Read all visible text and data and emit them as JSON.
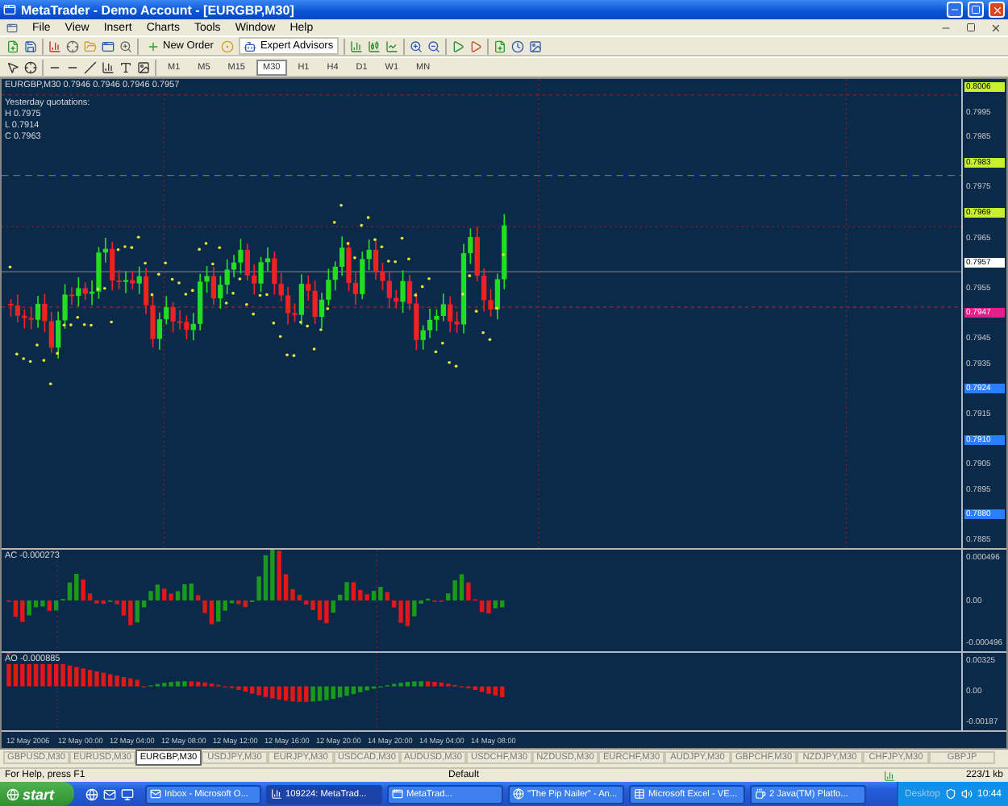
{
  "window": {
    "title": "MetaTrader - Demo Account - [EURGBP,M30]"
  },
  "menu": [
    "File",
    "View",
    "Insert",
    "Charts",
    "Tools",
    "Window",
    "Help"
  ],
  "toolbar": {
    "buttons": [
      "New Order",
      "Expert Advisors"
    ]
  },
  "timeframes": [
    {
      "label": "M1",
      "selected": false
    },
    {
      "label": "M5",
      "selected": false
    },
    {
      "label": "M15",
      "selected": false
    },
    {
      "label": "M30",
      "selected": true
    },
    {
      "label": "H1",
      "selected": false
    },
    {
      "label": "H4",
      "selected": false
    },
    {
      "label": "D1",
      "selected": false
    },
    {
      "label": "W1",
      "selected": false
    },
    {
      "label": "MN",
      "selected": false
    }
  ],
  "chart": {
    "header": "EURGBP,M30  0.7946 0.7946 0.7946 0.7957",
    "quotes_title": "Yesterday quotations:",
    "quotes": [
      "H 0.7975",
      "L 0.7914",
      "C 0.7963"
    ],
    "price_axis": [
      {
        "label": "0.8006",
        "kind": "tag",
        "color": "#c8f02c"
      },
      {
        "label": "0.7995",
        "kind": "tick"
      },
      {
        "label": "0.7985",
        "kind": "tick"
      },
      {
        "label": "0.7983",
        "kind": "tag",
        "color": "#c8f02c"
      },
      {
        "label": "0.7975",
        "kind": "tick"
      },
      {
        "label": "0.7969",
        "kind": "tag",
        "color": "#c8f02c"
      },
      {
        "label": "0.7965",
        "kind": "tick"
      },
      {
        "label": "0.7957",
        "kind": "tag",
        "color": "#ffffff"
      },
      {
        "label": "0.7955",
        "kind": "tick"
      },
      {
        "label": "0.7947",
        "kind": "tag",
        "color": "#e0218a"
      },
      {
        "label": "0.7945",
        "kind": "tick"
      },
      {
        "label": "0.7935",
        "kind": "tick"
      },
      {
        "label": "0.7924",
        "kind": "tag",
        "color": "#2a7fff"
      },
      {
        "label": "0.7915",
        "kind": "tick"
      },
      {
        "label": "0.7910",
        "kind": "tag",
        "color": "#2a7fff"
      },
      {
        "label": "0.7905",
        "kind": "tick"
      },
      {
        "label": "0.7895",
        "kind": "tick"
      },
      {
        "label": "0.7880",
        "kind": "tag",
        "color": "#2a7fff"
      },
      {
        "label": "0.7885",
        "kind": "tick"
      }
    ]
  },
  "indicators": [
    {
      "label": "AC -0.000273",
      "axis": [
        "0.000496",
        "0.00",
        "-0.000496"
      ]
    },
    {
      "label": "AO -0.000885",
      "axis": [
        "0.00325",
        "0.00",
        "-0.00187"
      ]
    }
  ],
  "time_axis": [
    "12 May 2006",
    "12 May 00:00",
    "12 May 04:00",
    "12 May 08:00",
    "12 May 12:00",
    "12 May 16:00",
    "12 May 20:00",
    "14 May 20:00",
    "14 May 04:00",
    "14 May 08:00"
  ],
  "tabs": [
    {
      "label": "GBPUSD,M30",
      "selected": false
    },
    {
      "label": "EURUSD,M30",
      "selected": false
    },
    {
      "label": "EURGBP,M30",
      "selected": true
    },
    {
      "label": "USDJPY,M30",
      "selected": false
    },
    {
      "label": "EURJPY,M30",
      "selected": false
    },
    {
      "label": "USDCAD,M30",
      "selected": false
    },
    {
      "label": "AUDUSD,M30",
      "selected": false
    },
    {
      "label": "USDCHF,M30",
      "selected": false
    },
    {
      "label": "NZDUSD,M30",
      "selected": false
    },
    {
      "label": "EURCHF,M30",
      "selected": false
    },
    {
      "label": "AUDJPY,M30",
      "selected": false
    },
    {
      "label": "GBPCHF,M30",
      "selected": false
    },
    {
      "label": "NZDJPY,M30",
      "selected": false
    },
    {
      "label": "CHFJPY,M30",
      "selected": false
    },
    {
      "label": "GBPJP",
      "selected": false
    }
  ],
  "status_bar": {
    "help": "For Help, press F1",
    "profile": "Default",
    "traffic": "223/1 kb"
  },
  "taskbar": {
    "start": "start",
    "items": [
      {
        "label": "Inbox - Microsoft O...",
        "selected": false
      },
      {
        "label": "109224: MetaTrad...",
        "selected": true
      },
      {
        "label": "MetaTrad...",
        "selected": false
      },
      {
        "label": "\"The Pip Nailer\" - An...",
        "selected": false
      },
      {
        "label": "Microsoft Excel - VE...",
        "selected": false
      },
      {
        "label": "2 Java(TM) Platfo...",
        "selected": false
      }
    ],
    "desktop": "Desktop",
    "clock": "10:44"
  }
}
